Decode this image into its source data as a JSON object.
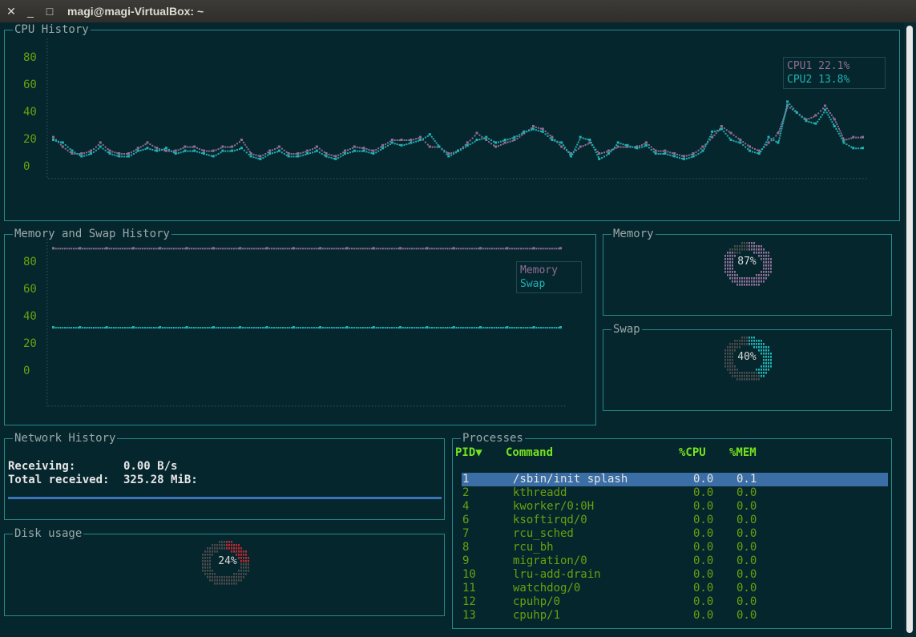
{
  "window": {
    "title": "magi@magi-VirtualBox: ~",
    "close_glyph": "✕",
    "minimize_glyph": "_",
    "maximize_glyph": "□"
  },
  "cpu_history": {
    "title": "CPU History",
    "yticks": [
      "80",
      "60",
      "40",
      "20",
      "0"
    ],
    "legend": [
      {
        "label": "CPU1",
        "value": "22.1%",
        "color": "#8f6f95"
      },
      {
        "label": "CPU2",
        "value": "13.8%",
        "color": "#1fb2b2"
      }
    ]
  },
  "mem_history": {
    "title": "Memory and Swap History",
    "yticks": [
      "80",
      "60",
      "40",
      "20",
      "0"
    ],
    "legend": [
      {
        "label": "Memory",
        "color": "#8f6f95"
      },
      {
        "label": "Swap",
        "color": "#1fb2b2"
      }
    ]
  },
  "memory_gauge": {
    "title": "Memory",
    "label": "87%",
    "value": 0.87,
    "color": "#8f6f95"
  },
  "swap_gauge": {
    "title": "Swap",
    "label": "40%",
    "value": 0.4,
    "color": "#1fb2b2"
  },
  "network": {
    "title": "Network History",
    "receiving_label": "Receiving:",
    "receiving_value": "0.00 B/s",
    "total_label": "Total received:",
    "total_value": "325.28 MiB:"
  },
  "disk": {
    "title": "Disk usage",
    "label": "24%",
    "value": 0.24,
    "color": "#c0272d"
  },
  "processes": {
    "title": "Processes",
    "headers": {
      "pid": "PID▼",
      "command": "Command",
      "cpu": "%CPU",
      "mem": "%MEM"
    },
    "rows": [
      {
        "pid": "1",
        "command": "/sbin/init splash",
        "cpu": "0.0",
        "mem": "0.1"
      },
      {
        "pid": "2",
        "command": "kthreadd",
        "cpu": "0.0",
        "mem": "0.0"
      },
      {
        "pid": "4",
        "command": "kworker/0:0H",
        "cpu": "0.0",
        "mem": "0.0"
      },
      {
        "pid": "6",
        "command": "ksoftirqd/0",
        "cpu": "0.0",
        "mem": "0.0"
      },
      {
        "pid": "7",
        "command": "rcu_sched",
        "cpu": "0.0",
        "mem": "0.0"
      },
      {
        "pid": "8",
        "command": "rcu_bh",
        "cpu": "0.0",
        "mem": "0.0"
      },
      {
        "pid": "9",
        "command": "migration/0",
        "cpu": "0.0",
        "mem": "0.0"
      },
      {
        "pid": "10",
        "command": "lru-add-drain",
        "cpu": "0.0",
        "mem": "0.0"
      },
      {
        "pid": "11",
        "command": "watchdog/0",
        "cpu": "0.0",
        "mem": "0.0"
      },
      {
        "pid": "12",
        "command": "cpuhp/0",
        "cpu": "0.0",
        "mem": "0.0"
      },
      {
        "pid": "13",
        "command": "cpuhp/1",
        "cpu": "0.0",
        "mem": "0.0"
      }
    ]
  },
  "chart_data": [
    {
      "type": "line",
      "title": "CPU History",
      "ylim": [
        0,
        80
      ],
      "grid": false,
      "legend_position": "top-right",
      "series": [
        {
          "name": "CPU1",
          "color": "#8f6f95",
          "values": [
            22,
            15,
            10,
            10,
            12,
            18,
            12,
            10,
            10,
            14,
            18,
            14,
            12,
            12,
            15,
            15,
            12,
            12,
            15,
            15,
            20,
            10,
            8,
            12,
            15,
            10,
            10,
            12,
            15,
            10,
            8,
            12,
            15,
            14,
            12,
            16,
            20,
            20,
            20,
            22,
            15,
            15,
            10,
            12,
            18,
            25,
            20,
            15,
            18,
            20,
            25,
            30,
            28,
            22,
            15,
            10,
            15,
            18,
            10,
            12,
            15,
            15,
            15,
            18,
            12,
            12,
            10,
            8,
            10,
            15,
            22,
            30,
            25,
            20,
            15,
            12,
            18,
            25,
            45,
            40,
            35,
            38,
            45,
            35,
            20,
            22,
            22
          ]
        },
        {
          "name": "CPU2",
          "color": "#1fb2b2",
          "values": [
            20,
            18,
            12,
            8,
            10,
            15,
            10,
            8,
            8,
            12,
            14,
            12,
            14,
            10,
            12,
            12,
            10,
            8,
            12,
            12,
            14,
            8,
            6,
            10,
            12,
            8,
            8,
            10,
            12,
            8,
            6,
            10,
            12,
            12,
            10,
            14,
            18,
            16,
            18,
            20,
            24,
            15,
            8,
            12,
            16,
            20,
            22,
            18,
            20,
            22,
            26,
            28,
            26,
            20,
            18,
            8,
            22,
            20,
            6,
            10,
            18,
            16,
            14,
            16,
            10,
            10,
            8,
            6,
            8,
            12,
            26,
            28,
            20,
            18,
            12,
            10,
            22,
            18,
            48,
            40,
            34,
            32,
            42,
            30,
            18,
            14,
            14
          ]
        }
      ]
    },
    {
      "type": "line",
      "title": "Memory and Swap History",
      "ylim": [
        0,
        80
      ],
      "grid": false,
      "legend_position": "top-right",
      "series": [
        {
          "name": "Memory",
          "color": "#8f6f95",
          "values": [
            87,
            87,
            87,
            87,
            87,
            87,
            87,
            87,
            87,
            87,
            87,
            87,
            87,
            87,
            87,
            87,
            87,
            87,
            87,
            87
          ]
        },
        {
          "name": "Swap",
          "color": "#1fb2b2",
          "values": [
            40,
            40,
            40,
            40,
            40,
            40,
            40,
            40,
            40,
            40,
            40,
            40,
            40,
            40,
            40,
            40,
            40,
            40,
            40,
            40
          ]
        }
      ]
    }
  ]
}
